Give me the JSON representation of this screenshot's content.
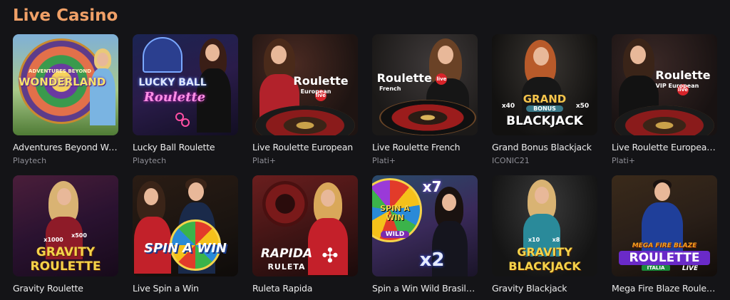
{
  "section": {
    "title": "Live Casino"
  },
  "games": [
    {
      "name": "Adventures Beyond Wo...",
      "provider": "Playtech",
      "logo": "WONDERLAND",
      "logo_sub": "ADVENTURES BEYOND"
    },
    {
      "name": "Lucky Ball Roulette",
      "provider": "Playtech",
      "logo": "LUCKY BALL",
      "logo_sub": "Roulette"
    },
    {
      "name": "Live Roulette European",
      "provider": "Plati+",
      "logo": "Roulette",
      "logo_sub": "European",
      "live": "live"
    },
    {
      "name": "Live Roulette French",
      "provider": "Plati+",
      "logo": "Roulette",
      "logo_sub": "French",
      "live": "live"
    },
    {
      "name": "Grand Bonus Blackjack",
      "provider": "ICONIC21",
      "logo": "BLACKJACK",
      "logo_sub": "GRAND",
      "logo_mid": "BONUS",
      "mult_a": "x40",
      "mult_b": "x50"
    },
    {
      "name": "Live Roulette European ...",
      "provider": "Plati+",
      "logo": "Roulette",
      "logo_sub": "VIP European",
      "live": "live"
    },
    {
      "name": "Gravity Roulette",
      "provider": "",
      "logo": "ROULETTE",
      "logo_sub": "GRAVITY",
      "mult_a": "x1000",
      "mult_b": "x500"
    },
    {
      "name": "Live Spin a Win",
      "provider": "",
      "logo": "SPIN A WIN"
    },
    {
      "name": "Ruleta Rapida",
      "provider": "",
      "logo": "RAPIDA",
      "logo_sub": "RULETA"
    },
    {
      "name": "Spin a Win Wild Brasileiro",
      "provider": "",
      "logo": "SPIN A WIN",
      "logo_sub": "WILD",
      "mult_a": "x7",
      "mult_b": "x2"
    },
    {
      "name": "Gravity Blackjack",
      "provider": "",
      "logo": "BLACKJACK",
      "logo_sub": "GRAVITY",
      "mult_a": "x10",
      "mult_b": "x8"
    },
    {
      "name": "Mega Fire Blaze Roulett...",
      "provider": "",
      "logo": "ROULETTE",
      "logo_sub": "MEGA FIRE BLAZE",
      "logo_mid": "LIVE",
      "badge": "ITALIA"
    }
  ],
  "colors": {
    "accent": "#f0a067",
    "background": "#141417",
    "provider_text": "#8f8f96"
  }
}
